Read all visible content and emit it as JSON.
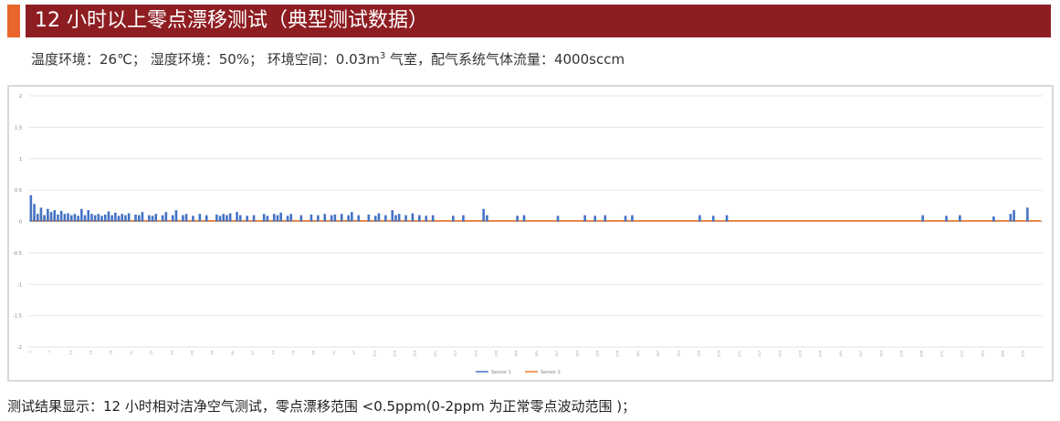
{
  "header": {
    "title": "12 小时以上零点漂移测试（典型测试数据）",
    "accent_color": "#e8662b",
    "bar_color": "#8e1d22"
  },
  "conditions": {
    "text_before_sup": "温度环境：26℃；  湿度环境：50%；  环境空间：0.03m",
    "sup": "3",
    "text_after_sup": " 气室，配气系统气体流量：4000sccm"
  },
  "result": {
    "text": "测试结果显示：12 小时相对洁净空气测试，零点漂移范围 <0.5ppm(0-2ppm 为正常零点波动范围 )；"
  },
  "chart_data": {
    "type": "bar",
    "title": "",
    "xlabel": "",
    "ylabel": "",
    "ylim": [
      -2,
      2
    ],
    "yticks": [
      2,
      1.5,
      1,
      0.5,
      0,
      -0.5,
      -1,
      -1.5,
      -2
    ],
    "grid": true,
    "legend_position": "bottom-center",
    "sample_count": 300,
    "x_tick_step": 6,
    "series": [
      {
        "name": "Sensor 1",
        "color": "#4472c4",
        "style": "bars",
        "points": [
          [
            1,
            0.42
          ],
          [
            2,
            0.28
          ],
          [
            3,
            0.12
          ],
          [
            4,
            0.22
          ],
          [
            5,
            0.1
          ],
          [
            6,
            0.2
          ],
          [
            7,
            0.15
          ],
          [
            8,
            0.18
          ],
          [
            9,
            0.11
          ],
          [
            10,
            0.17
          ],
          [
            11,
            0.12
          ],
          [
            12,
            0.13
          ],
          [
            13,
            0.1
          ],
          [
            14,
            0.12
          ],
          [
            15,
            0.09
          ],
          [
            16,
            0.2
          ],
          [
            17,
            0.1
          ],
          [
            18,
            0.18
          ],
          [
            19,
            0.12
          ],
          [
            20,
            0.1
          ],
          [
            21,
            0.12
          ],
          [
            22,
            0.09
          ],
          [
            23,
            0.11
          ],
          [
            24,
            0.16
          ],
          [
            25,
            0.1
          ],
          [
            26,
            0.14
          ],
          [
            27,
            0.09
          ],
          [
            28,
            0.12
          ],
          [
            29,
            0.1
          ],
          [
            30,
            0.13
          ],
          [
            32,
            0.11
          ],
          [
            33,
            0.1
          ],
          [
            34,
            0.15
          ],
          [
            36,
            0.1
          ],
          [
            37,
            0.09
          ],
          [
            38,
            0.12
          ],
          [
            40,
            0.1
          ],
          [
            41,
            0.15
          ],
          [
            43,
            0.1
          ],
          [
            44,
            0.18
          ],
          [
            46,
            0.1
          ],
          [
            47,
            0.12
          ],
          [
            49,
            0.09
          ],
          [
            51,
            0.12
          ],
          [
            53,
            0.1
          ],
          [
            56,
            0.11
          ],
          [
            57,
            0.09
          ],
          [
            58,
            0.12
          ],
          [
            59,
            0.1
          ],
          [
            60,
            0.13
          ],
          [
            62,
            0.15
          ],
          [
            63,
            0.1
          ],
          [
            65,
            0.09
          ],
          [
            67,
            0.1
          ],
          [
            70,
            0.12
          ],
          [
            71,
            0.09
          ],
          [
            73,
            0.12
          ],
          [
            74,
            0.1
          ],
          [
            75,
            0.14
          ],
          [
            77,
            0.09
          ],
          [
            78,
            0.12
          ],
          [
            81,
            0.1
          ],
          [
            84,
            0.11
          ],
          [
            86,
            0.1
          ],
          [
            88,
            0.12
          ],
          [
            90,
            0.1
          ],
          [
            91,
            0.11
          ],
          [
            93,
            0.12
          ],
          [
            95,
            0.1
          ],
          [
            96,
            0.15
          ],
          [
            98,
            0.1
          ],
          [
            101,
            0.11
          ],
          [
            103,
            0.09
          ],
          [
            104,
            0.13
          ],
          [
            106,
            0.1
          ],
          [
            108,
            0.18
          ],
          [
            109,
            0.1
          ],
          [
            110,
            0.12
          ],
          [
            112,
            0.1
          ],
          [
            114,
            0.13
          ],
          [
            116,
            0.1
          ],
          [
            118,
            0.09
          ],
          [
            120,
            0.1
          ],
          [
            126,
            0.09
          ],
          [
            129,
            0.1
          ],
          [
            135,
            0.2
          ],
          [
            136,
            0.1
          ],
          [
            145,
            0.09
          ],
          [
            147,
            0.1
          ],
          [
            157,
            0.09
          ],
          [
            165,
            0.1
          ],
          [
            168,
            0.09
          ],
          [
            171,
            0.1
          ],
          [
            177,
            0.09
          ],
          [
            179,
            0.1
          ],
          [
            199,
            0.1
          ],
          [
            203,
            0.09
          ],
          [
            207,
            0.1
          ],
          [
            265,
            0.1
          ],
          [
            272,
            0.09
          ],
          [
            276,
            0.1
          ],
          [
            286,
            0.08
          ],
          [
            291,
            0.12
          ],
          [
            292,
            0.18
          ],
          [
            296,
            0.22
          ]
        ]
      },
      {
        "name": "Sensor 2",
        "color": "#ed7d31",
        "style": "line",
        "baseline": 0.01,
        "points": [
          [
            1,
            0.1
          ],
          [
            2,
            0.08
          ],
          [
            3,
            0.12
          ],
          [
            4,
            0.09
          ],
          [
            5,
            0.1
          ],
          [
            6,
            0.11
          ],
          [
            7,
            0.06
          ],
          [
            8,
            0.08
          ]
        ]
      }
    ]
  }
}
